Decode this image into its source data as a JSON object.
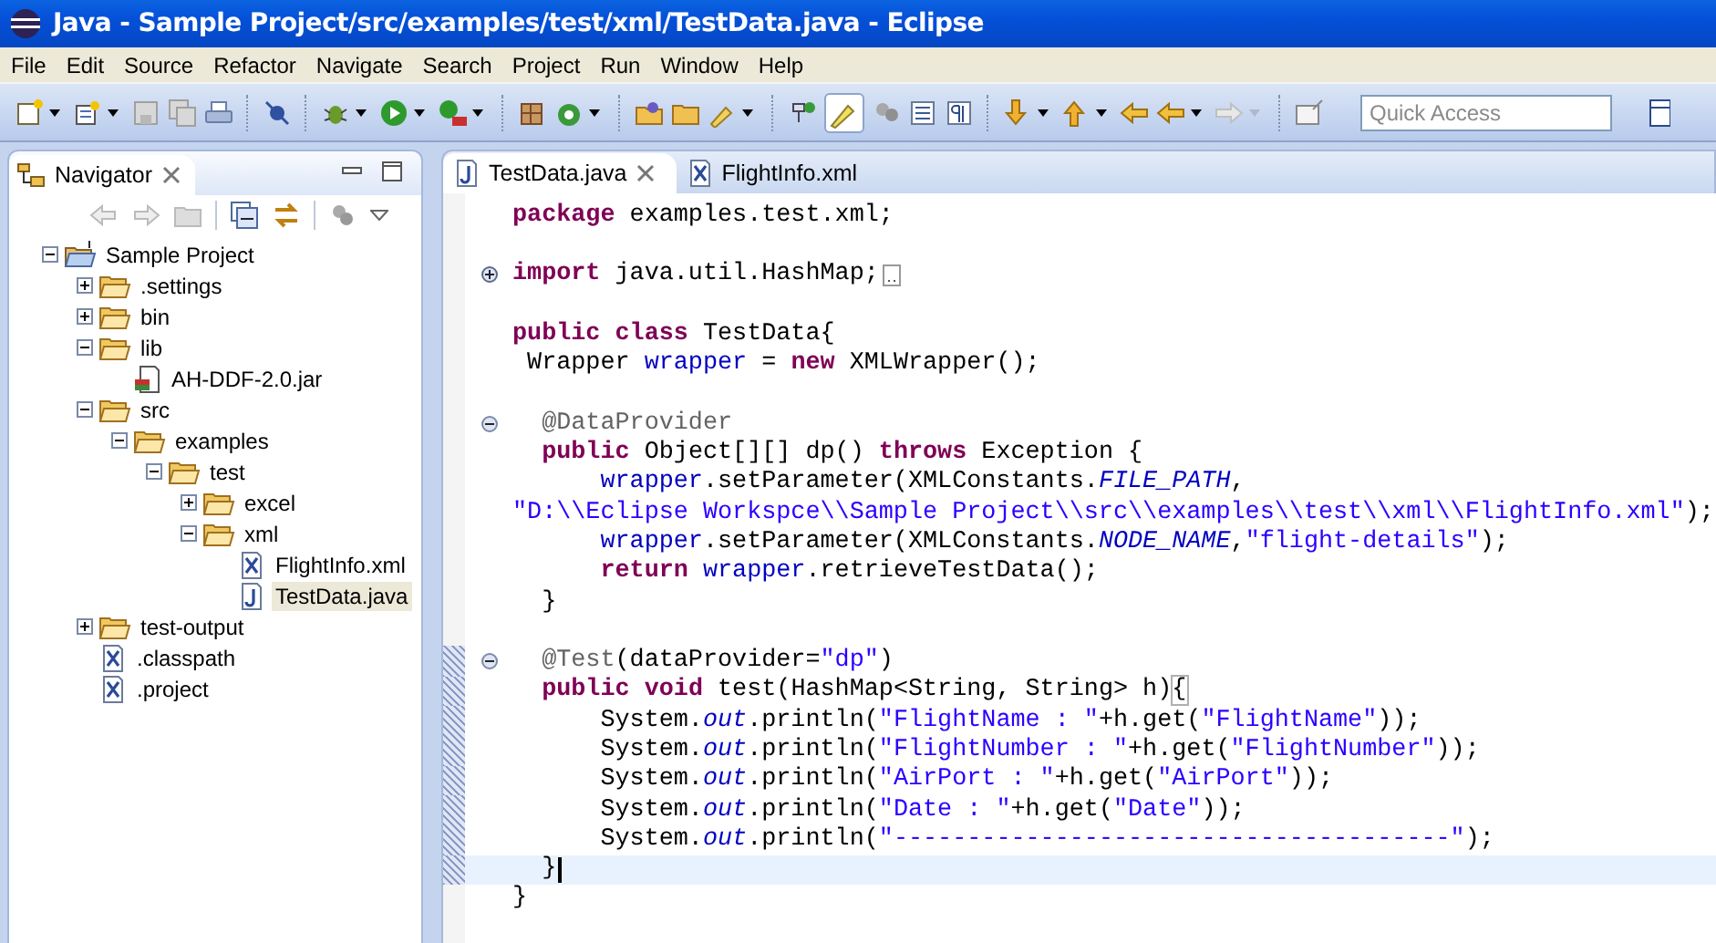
{
  "window": {
    "title": "Java - Sample Project/src/examples/test/xml/TestData.java - Eclipse"
  },
  "menu": [
    "File",
    "Edit",
    "Source",
    "Refactor",
    "Navigate",
    "Search",
    "Project",
    "Run",
    "Window",
    "Help"
  ],
  "quick_access": {
    "placeholder": "Quick Access"
  },
  "navigator": {
    "title": "Navigator",
    "tree": [
      {
        "label": "Sample Project",
        "kind": "project",
        "expanded": true,
        "selected": false,
        "children": [
          {
            "label": ".settings",
            "kind": "folder",
            "expanded": false,
            "selected": false
          },
          {
            "label": "bin",
            "kind": "folder",
            "expanded": false,
            "selected": false
          },
          {
            "label": "lib",
            "kind": "folder",
            "expanded": true,
            "selected": false,
            "children": [
              {
                "label": "AH-DDF-2.0.jar",
                "kind": "jar",
                "selected": false
              }
            ]
          },
          {
            "label": "src",
            "kind": "folder",
            "expanded": true,
            "selected": false,
            "children": [
              {
                "label": "examples",
                "kind": "folder",
                "expanded": true,
                "selected": false,
                "children": [
                  {
                    "label": "test",
                    "kind": "folder",
                    "expanded": true,
                    "selected": false,
                    "children": [
                      {
                        "label": "excel",
                        "kind": "folder",
                        "expanded": false,
                        "selected": false
                      },
                      {
                        "label": "xml",
                        "kind": "folder",
                        "expanded": true,
                        "selected": false,
                        "children": [
                          {
                            "label": "FlightInfo.xml",
                            "kind": "xml",
                            "selected": false
                          },
                          {
                            "label": "TestData.java",
                            "kind": "java",
                            "selected": true
                          }
                        ]
                      }
                    ]
                  }
                ]
              }
            ]
          },
          {
            "label": "test-output",
            "kind": "folder",
            "expanded": false,
            "selected": false
          },
          {
            "label": ".classpath",
            "kind": "xml",
            "selected": false
          },
          {
            "label": ".project",
            "kind": "xml",
            "selected": false
          }
        ]
      }
    ]
  },
  "editor": {
    "tabs": [
      {
        "label": "TestData.java",
        "kind": "java",
        "selected": true
      },
      {
        "label": "FlightInfo.xml",
        "kind": "xml",
        "selected": false
      }
    ],
    "lines": [
      {
        "changed": false,
        "current": false,
        "tokens": [
          {
            "kind": "kw",
            "text": "package"
          },
          {
            "kind": "plain",
            "text": " examples.test.xml;"
          }
        ]
      },
      {
        "changed": false,
        "current": false
      },
      {
        "folded": true,
        "changed": false,
        "current": false,
        "tokens": [
          {
            "kind": "kw",
            "text": "import"
          },
          {
            "kind": "plain",
            "text": " java.util.HashMap;"
          }
        ]
      },
      {
        "changed": false,
        "current": false
      },
      {
        "changed": false,
        "current": false,
        "tokens": [
          {
            "kind": "kw",
            "text": "public"
          },
          {
            "kind": "kw",
            "text": " class"
          },
          {
            "kind": "plain",
            "text": " TestData{"
          }
        ]
      },
      {
        "changed": false,
        "current": false,
        "tokens": [
          {
            "kind": "plain",
            "text": " Wrapper "
          },
          {
            "kind": "field",
            "text": "wrapper"
          },
          {
            "kind": "plain",
            "text": " = "
          },
          {
            "kind": "kw",
            "text": "new"
          },
          {
            "kind": "plain",
            "text": " XMLWrapper();"
          }
        ]
      },
      {
        "changed": false,
        "current": false
      },
      {
        "folded": false,
        "changed": false,
        "current": false,
        "tokens": [
          {
            "kind": "annot",
            "text": "  @DataProvider"
          }
        ]
      },
      {
        "changed": false,
        "current": false,
        "tokens": [
          {
            "kind": "kw",
            "text": "  public"
          },
          {
            "kind": "plain",
            "text": " Object[][] dp() "
          },
          {
            "kind": "kw",
            "text": "throws"
          },
          {
            "kind": "plain",
            "text": " Exception {"
          }
        ]
      },
      {
        "changed": false,
        "current": false,
        "tokens": [
          {
            "kind": "field",
            "text": "      wrapper"
          },
          {
            "kind": "plain",
            "text": ".setParameter(XMLConstants."
          },
          {
            "kind": "static",
            "text": "FILE_PATH"
          },
          {
            "kind": "plain",
            "text": ","
          }
        ]
      },
      {
        "changed": false,
        "current": false,
        "tokens": [
          {
            "kind": "str",
            "text": "\"D:\\\\Eclipse Workspce\\\\Sample Project\\\\src\\\\examples\\\\test\\\\xml\\\\FlightInfo.xml\""
          },
          {
            "kind": "plain",
            "text": ");"
          }
        ]
      },
      {
        "changed": false,
        "current": false,
        "tokens": [
          {
            "kind": "field",
            "text": "      wrapper"
          },
          {
            "kind": "plain",
            "text": ".setParameter(XMLConstants."
          },
          {
            "kind": "static",
            "text": "NODE_NAME"
          },
          {
            "kind": "plain",
            "text": ","
          },
          {
            "kind": "str",
            "text": "\"flight-details\""
          },
          {
            "kind": "plain",
            "text": ");"
          }
        ]
      },
      {
        "changed": false,
        "current": false,
        "tokens": [
          {
            "kind": "kw",
            "text": "      return"
          },
          {
            "kind": "field",
            "text": " wrapper"
          },
          {
            "kind": "plain",
            "text": ".retrieveTestData();"
          }
        ]
      },
      {
        "changed": false,
        "current": false,
        "tokens": [
          {
            "kind": "plain",
            "text": "  }"
          }
        ]
      },
      {
        "changed": false,
        "current": false
      },
      {
        "folded": false,
        "changed": true,
        "current": false,
        "tokens": [
          {
            "kind": "annot",
            "text": "  @Test"
          },
          {
            "kind": "plain",
            "text": "(dataProvider="
          },
          {
            "kind": "str",
            "text": "\"dp\""
          },
          {
            "kind": "plain",
            "text": ")"
          }
        ]
      },
      {
        "changed": true,
        "current": false,
        "tokens": [
          {
            "kind": "kw",
            "text": "  public"
          },
          {
            "kind": "kw",
            "text": " void"
          },
          {
            "kind": "plain",
            "text": " test(HashMap<String, String> h)"
          },
          {
            "kind": "match",
            "text": "{"
          }
        ]
      },
      {
        "changed": true,
        "current": false,
        "tokens": [
          {
            "kind": "plain",
            "text": "      System."
          },
          {
            "kind": "static",
            "text": "out"
          },
          {
            "kind": "plain",
            "text": ".println("
          },
          {
            "kind": "str",
            "text": "\"FlightName : \""
          },
          {
            "kind": "plain",
            "text": "+h.get("
          },
          {
            "kind": "str",
            "text": "\"FlightName\""
          },
          {
            "kind": "plain",
            "text": "));"
          }
        ]
      },
      {
        "changed": true,
        "current": false,
        "tokens": [
          {
            "kind": "plain",
            "text": "      System."
          },
          {
            "kind": "static",
            "text": "out"
          },
          {
            "kind": "plain",
            "text": ".println("
          },
          {
            "kind": "str",
            "text": "\"FlightNumber : \""
          },
          {
            "kind": "plain",
            "text": "+h.get("
          },
          {
            "kind": "str",
            "text": "\"FlightNumber\""
          },
          {
            "kind": "plain",
            "text": "));"
          }
        ]
      },
      {
        "changed": true,
        "current": false,
        "tokens": [
          {
            "kind": "plain",
            "text": "      System."
          },
          {
            "kind": "static",
            "text": "out"
          },
          {
            "kind": "plain",
            "text": ".println("
          },
          {
            "kind": "str",
            "text": "\"AirPort : \""
          },
          {
            "kind": "plain",
            "text": "+h.get("
          },
          {
            "kind": "str",
            "text": "\"AirPort\""
          },
          {
            "kind": "plain",
            "text": "));"
          }
        ]
      },
      {
        "changed": true,
        "current": false,
        "tokens": [
          {
            "kind": "plain",
            "text": "      System."
          },
          {
            "kind": "static",
            "text": "out"
          },
          {
            "kind": "plain",
            "text": ".println("
          },
          {
            "kind": "str",
            "text": "\"Date : \""
          },
          {
            "kind": "plain",
            "text": "+h.get("
          },
          {
            "kind": "str",
            "text": "\"Date\""
          },
          {
            "kind": "plain",
            "text": "));"
          }
        ]
      },
      {
        "changed": true,
        "current": false,
        "tokens": [
          {
            "kind": "plain",
            "text": "      System."
          },
          {
            "kind": "static",
            "text": "out"
          },
          {
            "kind": "plain",
            "text": ".println("
          },
          {
            "kind": "str",
            "text": "\"--------------------------------------\""
          },
          {
            "kind": "plain",
            "text": ");"
          }
        ]
      },
      {
        "changed": true,
        "current": true,
        "tokens": [
          {
            "kind": "plain",
            "text": "  }"
          }
        ]
      },
      {
        "changed": false,
        "current": false,
        "tokens": [
          {
            "kind": "plain",
            "text": "}"
          }
        ]
      }
    ]
  }
}
